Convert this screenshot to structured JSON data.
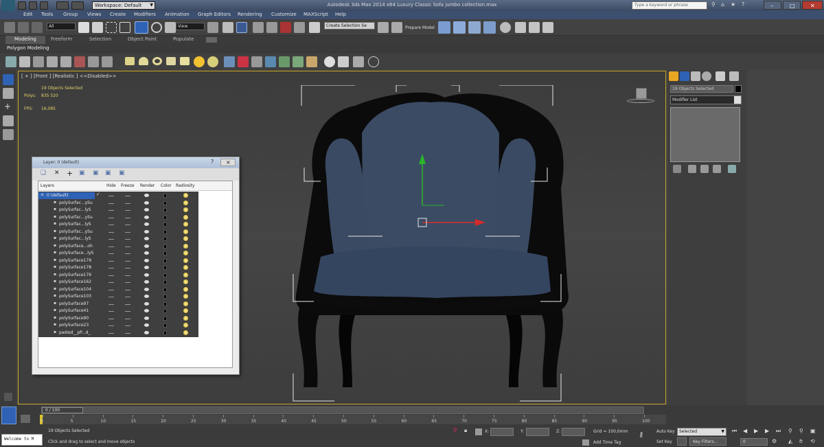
{
  "title_bar": {
    "workspace": "Workspace: Default",
    "title": "Autodesk 3ds Max  2014 x64      Luxury Classic Sofa jumbo collection.max",
    "search_placeholder": "Type a keyword or phrase"
  },
  "menu": [
    "Edit",
    "Tools",
    "Group",
    "Views",
    "Create",
    "Modifiers",
    "Animation",
    "Graph Editors",
    "Rendering",
    "Customize",
    "MAXScript",
    "Help"
  ],
  "toolbar": {
    "filter_value": "All",
    "coord_value": "View",
    "selection_set": "Create Selection Se",
    "prepare_model": "Prepare Model"
  },
  "ribbon": {
    "tabs": [
      "Modeling",
      "Freeform",
      "Selection",
      "Object Paint",
      "Populate"
    ],
    "panel_label": "Polygon Modeling"
  },
  "viewport": {
    "label": "[ + ] [Front ] [Realistic ]  <<Disabled>>",
    "stats_selected": "19 Objects Selected",
    "polys_label": "Polys:",
    "polys_value": "835 520",
    "fps_label": "FPS:",
    "fps_value": "16,085"
  },
  "layer_dialog": {
    "title": "Layer: 0 (default)",
    "help": "?",
    "close": "×",
    "columns": [
      "Layers",
      "Hide",
      "Freeze",
      "Render",
      "Color",
      "Radiosity"
    ],
    "default_layer": "0 (default)",
    "rows": [
      "polySurfac...ySu",
      "polySurfac...lyS",
      "polySurfac...ySu",
      "polySurfac...lyS",
      "polySurfac...ySu",
      "polySurfac...lyS",
      "polySurface...oh",
      "polySurface...lyS",
      "polySurface179",
      "polySurface178",
      "polySurface176",
      "polySurface162",
      "polySurface104",
      "polySurface103",
      "polySurface97",
      "polySurface41",
      "polySurface90",
      "polySurface23",
      "pasted__pP...d_"
    ]
  },
  "command_panel": {
    "selection_name": "19 Objects Selected",
    "modifier_list": "Modifier List"
  },
  "timeline": {
    "frame_display": "0 / 100",
    "ticks": [
      "0",
      "5",
      "10",
      "15",
      "20",
      "25",
      "30",
      "35",
      "40",
      "45",
      "50",
      "55",
      "60",
      "65",
      "70",
      "75",
      "80",
      "85",
      "90",
      "95",
      "100"
    ]
  },
  "status": {
    "welcome": "Welcome to M",
    "selected_text": "19 Objects Selected",
    "prompt": "Click and drag to select and move objects",
    "x_label": "X:",
    "y_label": "Y:",
    "z_label": "Z:",
    "grid": "Grid = 100,0mm",
    "add_time_tag": "Add Time Tag",
    "auto_key": "Auto Key",
    "set_key": "Set Key",
    "key_mode": "Selected",
    "key_filters": "Key Filters...",
    "frame": "0"
  },
  "colors": {
    "viewport_border": "#c8a620",
    "sofa_fabric": "#3a4a63",
    "sofa_frame": "#0a0a0a",
    "highlight": "#2f62b5"
  }
}
